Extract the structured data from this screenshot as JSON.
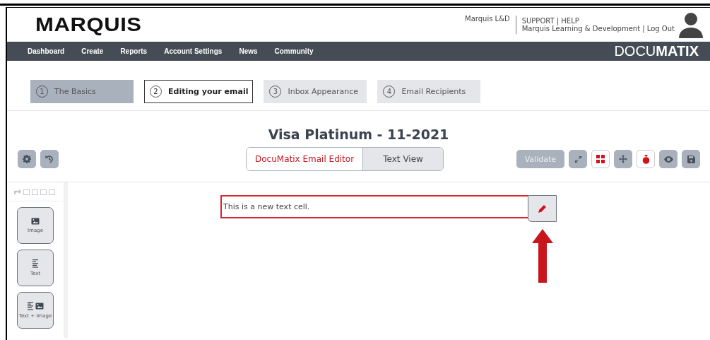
{
  "header": {
    "logo": "MARQUIS",
    "account": "Marquis L&D",
    "support_links": "SUPPORT | HELP",
    "org_line": "Marquis Learning & Development | Log Out"
  },
  "nav": {
    "items": [
      "Dashboard",
      "Create",
      "Reports",
      "Account Settings",
      "News",
      "Community"
    ],
    "brand": "DOCU**MATIX**"
  },
  "steps": [
    {
      "number": "1",
      "label": "The Basics",
      "completed": true,
      "selected": false
    },
    {
      "number": "2",
      "label": "Editing your email",
      "completed": false,
      "selected": true
    },
    {
      "number": "3",
      "label": "Inbox Appearance",
      "completed": false,
      "selected": false
    },
    {
      "number": "4",
      "label": "Email Recipients",
      "completed": false,
      "selected": false
    }
  ],
  "title": "Visa Platinum - 11-2021",
  "left_tools": [
    {
      "kind": "settings"
    },
    {
      "kind": "history"
    }
  ],
  "view_toggle": [
    {
      "label": "DocuMatix Email Editor",
      "selected": true
    },
    {
      "label": "Text View",
      "selected": false
    }
  ],
  "validate_button": "Validate",
  "right_tools": [
    {
      "kind": "expand",
      "active": false
    },
    {
      "kind": "grid",
      "active": true
    },
    {
      "kind": "move",
      "active": false
    },
    {
      "kind": "stopwatch",
      "active": true
    },
    {
      "kind": "preview",
      "active": false
    },
    {
      "kind": "save",
      "active": false
    }
  ],
  "blocks": [
    {
      "kind": "image",
      "label": "Image"
    },
    {
      "kind": "text",
      "label": "Text"
    },
    {
      "kind": "text_image",
      "label": "Text + Image"
    }
  ],
  "text_cell": {
    "text": "This is a new text cell.",
    "selected": true
  }
}
